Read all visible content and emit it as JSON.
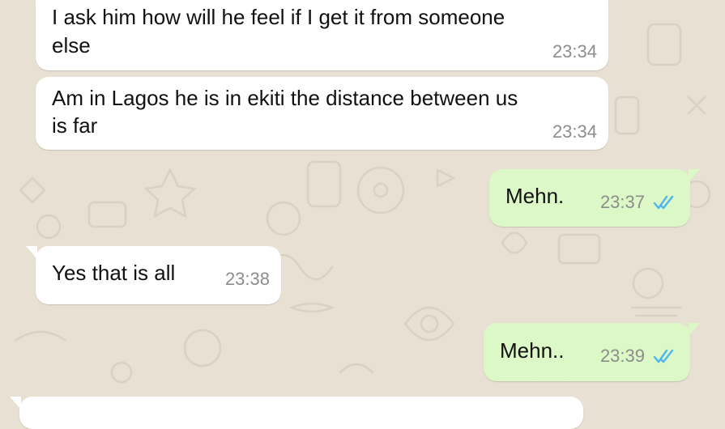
{
  "chat": {
    "messages": [
      {
        "direction": "incoming",
        "lines": [
          "I ask him how will he feel if I get it from someone",
          "else"
        ],
        "time": "23:34"
      },
      {
        "direction": "incoming",
        "lines": [
          "Am in Lagos he is in ekiti the distance between us",
          "is far"
        ],
        "time": "23:34"
      },
      {
        "direction": "outgoing",
        "text": "Mehn.",
        "time": "23:37",
        "status_icon": "double-check-read-icon"
      },
      {
        "direction": "incoming",
        "text": "Yes that is all",
        "time": "23:38"
      },
      {
        "direction": "outgoing",
        "text": "Mehn..",
        "time": "23:39",
        "status_icon": "double-check-read-icon"
      }
    ]
  },
  "colors": {
    "wallpaper": "#e8e0d3",
    "incoming_bubble": "#ffffff",
    "outgoing_bubble": "#dcf8c6",
    "read_ticks": "#4fb6ec",
    "timestamp": "#8c8c8c"
  }
}
